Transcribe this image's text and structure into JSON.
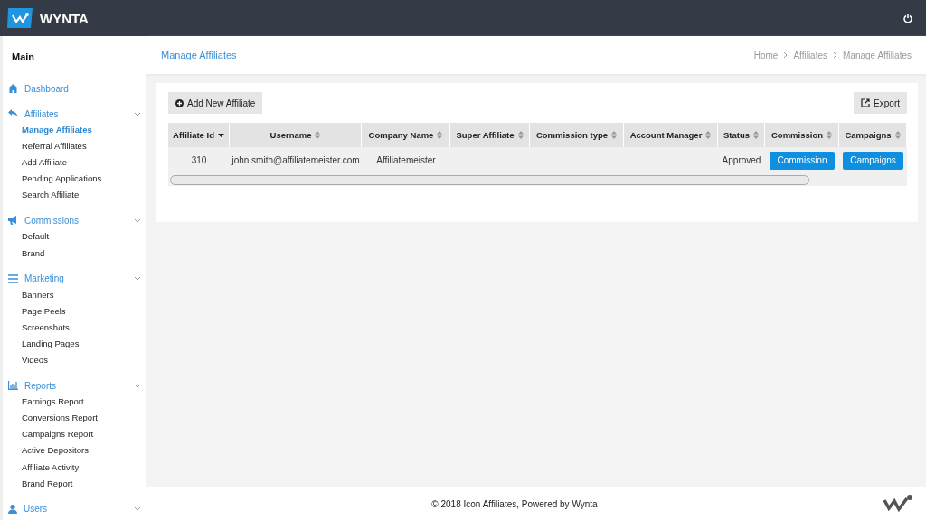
{
  "brand": {
    "name": "WYNTA"
  },
  "sidebar": {
    "heading": "Main",
    "groups": [
      {
        "label": "Dashboard",
        "submenu": false
      },
      {
        "label": "Affiliates",
        "submenu": true,
        "children": [
          {
            "label": "Manage Affiliates",
            "selected": true
          },
          {
            "label": "Referral Affiliates",
            "selected": false
          },
          {
            "label": "Add Affiliate",
            "selected": false
          },
          {
            "label": "Pending Applications",
            "selected": false
          },
          {
            "label": "Search Affiliate",
            "selected": false
          }
        ]
      },
      {
        "label": "Commissions",
        "submenu": true,
        "children": [
          {
            "label": "Default",
            "selected": false
          },
          {
            "label": "Brand",
            "selected": false
          }
        ]
      },
      {
        "label": "Marketing",
        "submenu": true,
        "children": [
          {
            "label": "Banners",
            "selected": false
          },
          {
            "label": "Page Peels",
            "selected": false
          },
          {
            "label": "Screenshots",
            "selected": false
          },
          {
            "label": "Landing Pages",
            "selected": false
          },
          {
            "label": "Videos",
            "selected": false
          }
        ]
      },
      {
        "label": "Reports",
        "submenu": true,
        "children": [
          {
            "label": "Earnings Report",
            "selected": false
          },
          {
            "label": "Conversions Report",
            "selected": false
          },
          {
            "label": "Campaigns Report",
            "selected": false
          },
          {
            "label": "Active Depositors",
            "selected": false
          },
          {
            "label": "Affiliate Activity",
            "selected": false
          },
          {
            "label": "Brand Report",
            "selected": false
          }
        ]
      },
      {
        "label": "Users",
        "submenu": true
      }
    ]
  },
  "page": {
    "title": "Manage Affiliates",
    "breadcrumbs": [
      "Home",
      "Affiliates",
      "Manage Affiliates"
    ]
  },
  "toolbar": {
    "add_button": "Add New Affiliate",
    "export_button": "Export"
  },
  "table": {
    "columns": [
      {
        "label": "Affiliate Id",
        "sorted": true
      },
      {
        "label": "Username",
        "sorted": false
      },
      {
        "label": "Company Name",
        "sorted": false
      },
      {
        "label": "Super Affiliate",
        "sorted": false
      },
      {
        "label": "Commission type",
        "sorted": false
      },
      {
        "label": "Account Manager",
        "sorted": false
      },
      {
        "label": "Status",
        "sorted": false
      },
      {
        "label": "Commission",
        "sorted": false
      },
      {
        "label": "Campaigns",
        "sorted": false
      }
    ],
    "rows": [
      [
        {
          "kind": "text",
          "text": "310"
        },
        {
          "kind": "text",
          "text": "john.smith@affiliatemeister.com"
        },
        {
          "kind": "text",
          "text": "Affiliatemeister"
        },
        {
          "kind": "empty"
        },
        {
          "kind": "empty"
        },
        {
          "kind": "empty"
        },
        {
          "kind": "text",
          "text": "Approved"
        },
        {
          "kind": "button",
          "text": "Commission"
        },
        {
          "kind": "button",
          "text": "Campaigns"
        }
      ]
    ]
  },
  "footer": {
    "text": "© 2018 Icon Affiliates, Powered by Wynta"
  }
}
